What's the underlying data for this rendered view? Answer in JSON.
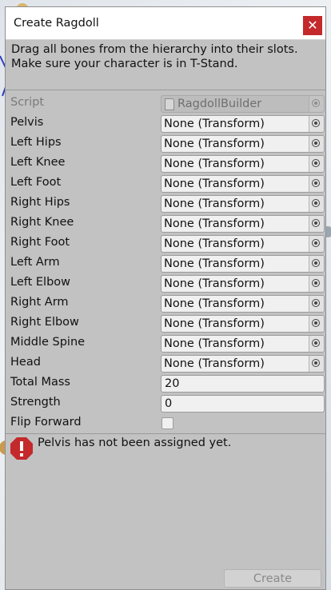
{
  "window": {
    "title": "Create Ragdoll",
    "close_glyph": "✕"
  },
  "help_text": {
    "line1": "Drag all bones from the hierarchy into their slots.",
    "line2": "Make sure your character is in T-Stand."
  },
  "script_field": {
    "label": "Script",
    "value": "RagdollBuilder"
  },
  "bones": [
    {
      "label": "Pelvis",
      "value": "None (Transform)"
    },
    {
      "label": "Left Hips",
      "value": "None (Transform)"
    },
    {
      "label": "Left Knee",
      "value": "None (Transform)"
    },
    {
      "label": "Left Foot",
      "value": "None (Transform)"
    },
    {
      "label": "Right Hips",
      "value": "None (Transform)"
    },
    {
      "label": "Right Knee",
      "value": "None (Transform)"
    },
    {
      "label": "Right Foot",
      "value": "None (Transform)"
    },
    {
      "label": "Left Arm",
      "value": "None (Transform)"
    },
    {
      "label": "Left Elbow",
      "value": "None (Transform)"
    },
    {
      "label": "Right Arm",
      "value": "None (Transform)"
    },
    {
      "label": "Right Elbow",
      "value": "None (Transform)"
    },
    {
      "label": "Middle Spine",
      "value": "None (Transform)"
    },
    {
      "label": "Head",
      "value": "None (Transform)"
    }
  ],
  "total_mass": {
    "label": "Total Mass",
    "value": "20"
  },
  "strength": {
    "label": "Strength",
    "value": "0"
  },
  "flip_forward": {
    "label": "Flip Forward",
    "checked": false
  },
  "error": {
    "message": "Pelvis has not been assigned yet.",
    "icon": "error-octagon-icon",
    "color": "#c4292c"
  },
  "create_button": {
    "label": "Create",
    "enabled": false
  }
}
